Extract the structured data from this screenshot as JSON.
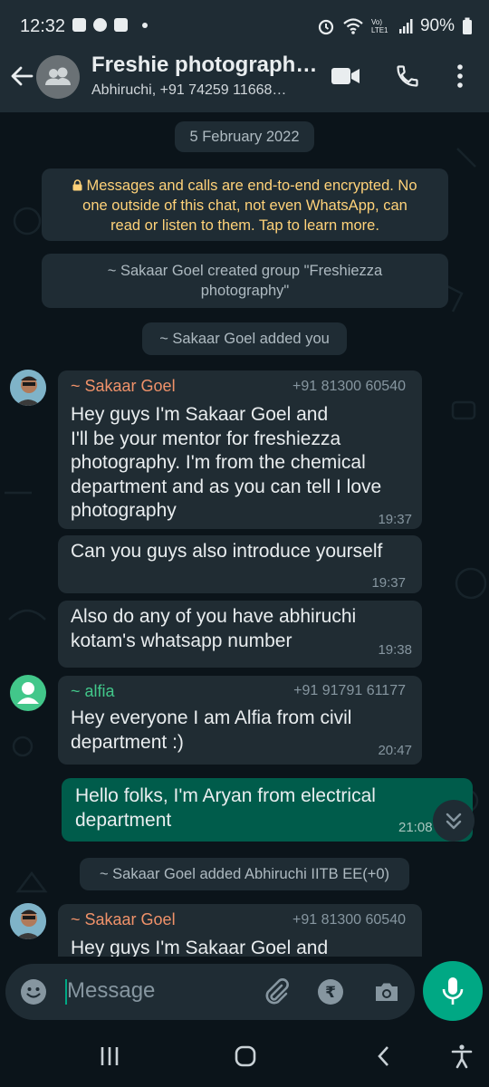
{
  "status_bar": {
    "time": "12:32",
    "battery": "90%",
    "network": "Vo) LTE1"
  },
  "header": {
    "title": "Freshie photograph…",
    "subtitle": "Abhiruchi, +91 74259 11668…"
  },
  "chat": {
    "date_chip": "5 February 2022",
    "encryption_note": [
      "Messages and calls are end-to-end encrypted. No",
      "one outside of this chat, not even WhatsApp, can",
      "read or listen to them. Tap to learn more."
    ],
    "system_created": [
      "~ Sakaar Goel created group \"Freshiezza",
      "photography\""
    ],
    "system_added_you": "~ Sakaar Goel added you",
    "messages": [
      {
        "sender": "~ Sakaar Goel",
        "phone": "+91 81300 60540",
        "lines": [
          "Hey guys I'm Sakaar Goel and",
          "I'll be your mentor for freshiezza",
          "photography. I'm from the chemical",
          "department and as you can tell I love",
          "photography"
        ],
        "time": "19:37"
      },
      {
        "lines": [
          "Can you guys also introduce yourself"
        ],
        "time": "19:37"
      },
      {
        "lines": [
          "Also do any of you have abhiruchi",
          "kotam's whatsapp number"
        ],
        "time": "19:38"
      },
      {
        "sender": "~ alfia",
        "phone": "+91 91791 61177",
        "lines": [
          "Hey everyone I am Alfia from civil",
          "department :)"
        ],
        "time": "20:47"
      },
      {
        "lines": [
          "Hello folks, I'm Aryan from electrical",
          "department"
        ],
        "time": "21:08"
      },
      {
        "sender": "~ Sakaar Goel",
        "phone": "+91 81300 60540",
        "lines": [
          "Hey guys I'm Sakaar Goel and"
        ]
      }
    ],
    "system_added_abhiruchi": "~ Sakaar Goel added Abhiruchi IITB EE(+0)"
  },
  "composer": {
    "placeholder": "Message"
  },
  "colors": {
    "background": "#0b141a",
    "bar": "#1f2c34",
    "incoming_bubble": "#202c33",
    "outgoing_bubble": "#005c4b",
    "accent": "#00a884",
    "sakaar_name": "#f0926a",
    "alfia_name": "#42c78a",
    "encryption_text": "#ffd279",
    "read_ticks": "#53bdeb"
  }
}
